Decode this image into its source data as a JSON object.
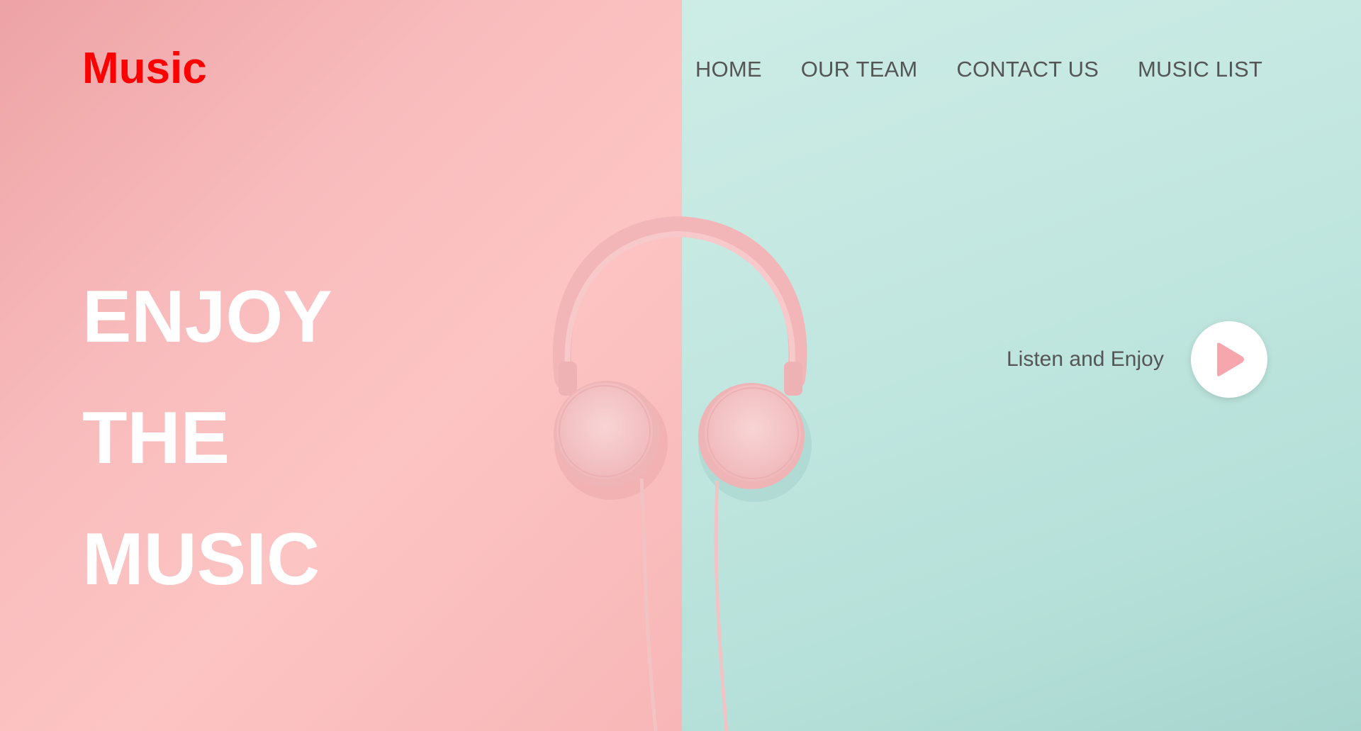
{
  "brand": {
    "logo_text": "Music",
    "logo_color": "#ff0000"
  },
  "nav": {
    "items": [
      {
        "label": "HOME"
      },
      {
        "label": "OUR TEAM"
      },
      {
        "label": "CONTACT US"
      },
      {
        "label": "MUSIC LIST"
      }
    ]
  },
  "hero": {
    "lines": [
      "ENJOY",
      "THE",
      "MUSIC"
    ]
  },
  "cta": {
    "label": "Listen and Enjoy",
    "icon": "play-icon",
    "icon_color": "#f7a6ad"
  },
  "background": {
    "left_color": "#fcc2c2",
    "right_color": "#c2e7e0",
    "image": "pink-headphones"
  }
}
